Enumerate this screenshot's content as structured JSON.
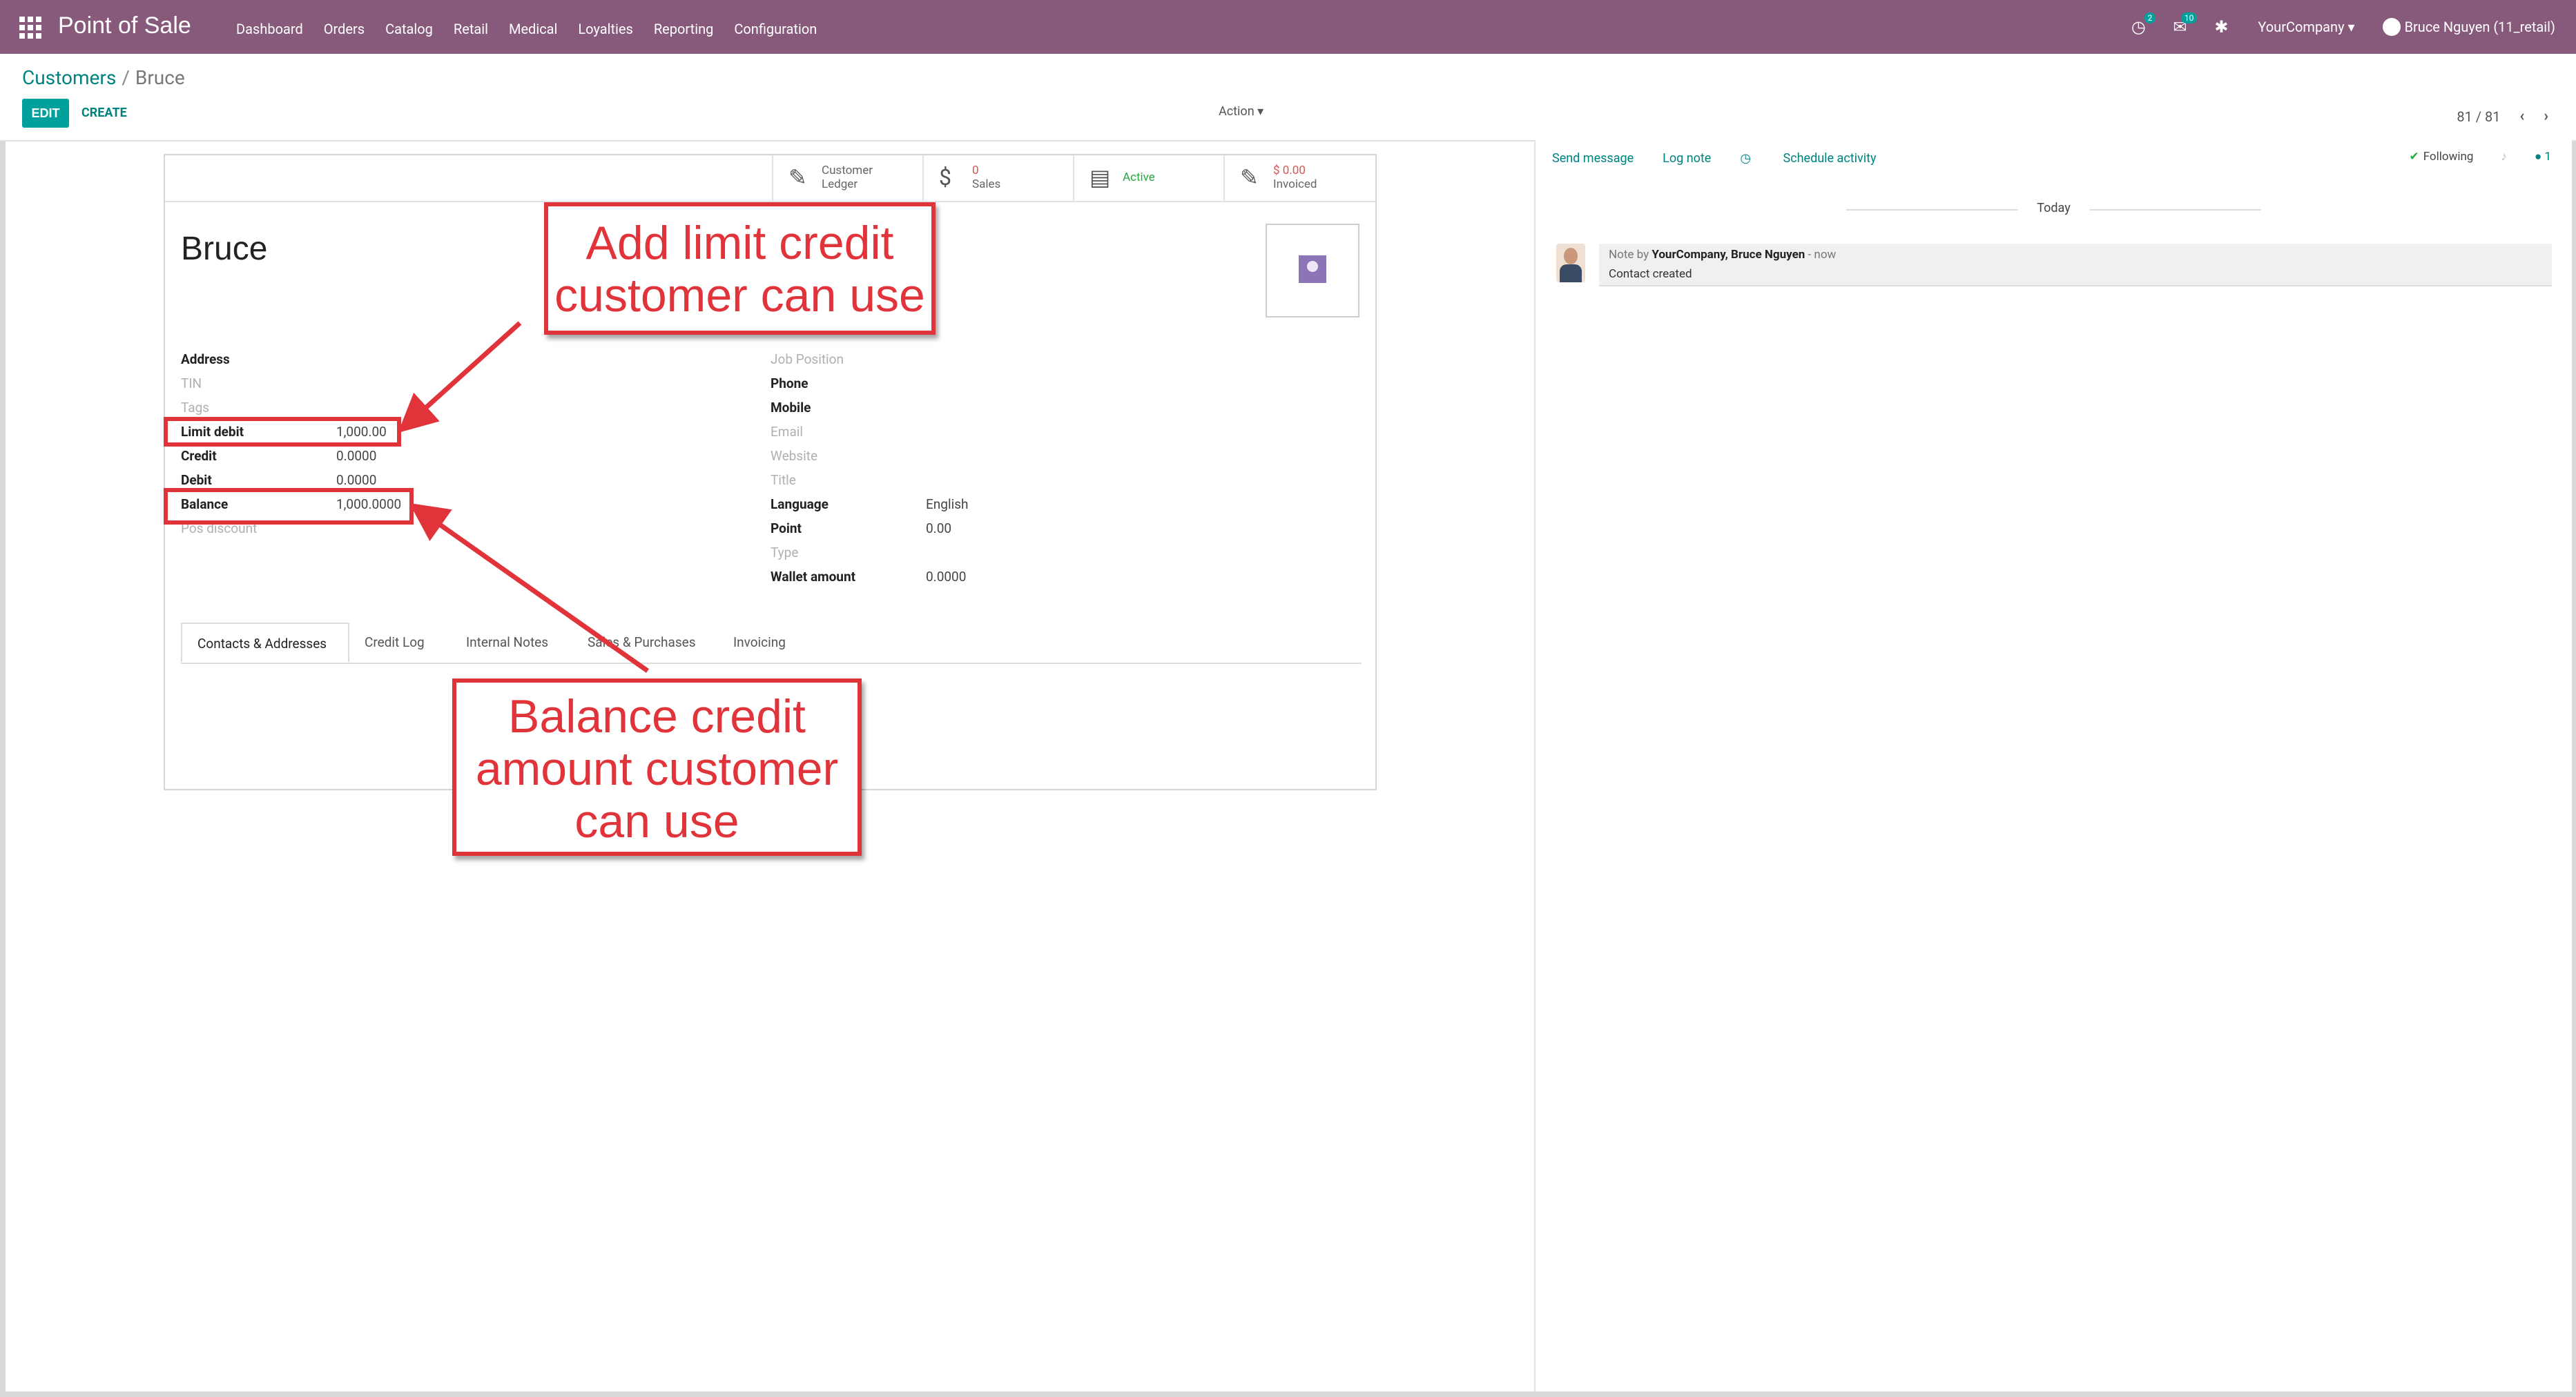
{
  "navbar": {
    "brand": "Point of Sale",
    "menu": [
      "Dashboard",
      "Orders",
      "Catalog",
      "Retail",
      "Medical",
      "Loyalties",
      "Reporting",
      "Configuration"
    ],
    "activity_badge": "2",
    "messages_badge": "10",
    "company": "YourCompany ▾",
    "user": "Bruce Nguyen (11_retail)"
  },
  "control_panel": {
    "breadcrumb_parent": "Customers",
    "breadcrumb_current": "Bruce",
    "edit_label": "EDIT",
    "create_label": "CREATE",
    "action_label": "Action ▾",
    "pager": "81 / 81"
  },
  "smart_buttons": {
    "ledger_line1": "Customer",
    "ledger_line2": "Ledger",
    "sales_count": "0",
    "sales_label": "Sales",
    "active_label": "Active",
    "invoiced_amount": "$ 0.00",
    "invoiced_label": "Invoiced"
  },
  "partner": {
    "name": "Bruce"
  },
  "left_fields": {
    "address": "Address",
    "tin": "TIN",
    "tags": "Tags",
    "limit_debit_label": "Limit debit",
    "limit_debit_value": "1,000.00",
    "credit_label": "Credit",
    "credit_value": "0.0000",
    "debit_label": "Debit",
    "debit_value": "0.0000",
    "balance_label": "Balance",
    "balance_value": "1,000.0000",
    "pos_discount": "Pos discount"
  },
  "right_fields": {
    "job_position": "Job Position",
    "phone": "Phone",
    "mobile": "Mobile",
    "email": "Email",
    "website": "Website",
    "title": "Title",
    "language_label": "Language",
    "language_value": "English",
    "point_label": "Point",
    "point_value": "0.00",
    "type": "Type",
    "wallet_label": "Wallet amount",
    "wallet_value": "0.0000"
  },
  "tabs": [
    "Contacts & Addresses",
    "Credit Log",
    "Internal Notes",
    "Sales & Purchases",
    "Invoicing"
  ],
  "chatter": {
    "send_message": "Send message",
    "log_note": "Log note",
    "schedule_activity": "Schedule activity",
    "following": "Following",
    "followers_count": "1",
    "today": "Today",
    "note_prefix": "Note by",
    "note_author": "YourCompany, Bruce Nguyen",
    "note_time": "- now",
    "note_body": "Contact created"
  },
  "annotations": {
    "callout_limit": "Add limit credit customer can use",
    "callout_balance": "Balance credit amount customer can use",
    "color": "#e0333a"
  },
  "colors": {
    "navbar": "#875a7b",
    "primary": "#00a09d",
    "link": "#00827f"
  }
}
